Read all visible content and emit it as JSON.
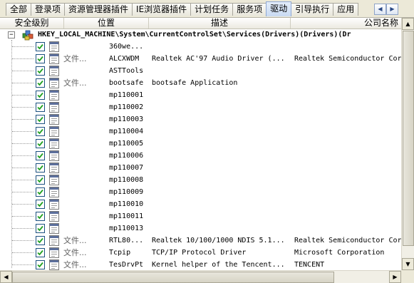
{
  "tabs": [
    {
      "label": "全部",
      "active": false
    },
    {
      "label": "登录项",
      "active": false
    },
    {
      "label": "资源管理器插件",
      "active": false
    },
    {
      "label": "IE浏览器插件",
      "active": false
    },
    {
      "label": "计划任务",
      "active": false
    },
    {
      "label": "服务项",
      "active": false
    },
    {
      "label": "驱动",
      "active": true
    },
    {
      "label": "引导执行",
      "active": false
    },
    {
      "label": "应用",
      "active": false
    }
  ],
  "columns": {
    "level": "安全级别",
    "location": "位置",
    "description": "描述",
    "company": "公司名称"
  },
  "root": {
    "expander": "⊟",
    "path": "HKEY_LOCAL_MACHINE\\System\\CurrentControlSet\\Services(Drivers)(Drivers)(Dr"
  },
  "rows": [
    {
      "type": "",
      "name": "360we...",
      "desc": "",
      "company": ""
    },
    {
      "type": "文件...",
      "name": "ALCXWDM",
      "desc": "Realtek AC'97 Audio Driver (...",
      "company": "Realtek Semiconductor Cor"
    },
    {
      "type": "",
      "name": "ASTTools",
      "desc": "",
      "company": ""
    },
    {
      "type": "文件...",
      "name": "bootsafe",
      "desc": "bootsafe Application",
      "company": ""
    },
    {
      "type": "",
      "name": "mp110001",
      "desc": "",
      "company": ""
    },
    {
      "type": "",
      "name": "mp110002",
      "desc": "",
      "company": ""
    },
    {
      "type": "",
      "name": "mp110003",
      "desc": "",
      "company": ""
    },
    {
      "type": "",
      "name": "mp110004",
      "desc": "",
      "company": ""
    },
    {
      "type": "",
      "name": "mp110005",
      "desc": "",
      "company": ""
    },
    {
      "type": "",
      "name": "mp110006",
      "desc": "",
      "company": ""
    },
    {
      "type": "",
      "name": "mp110007",
      "desc": "",
      "company": ""
    },
    {
      "type": "",
      "name": "mp110008",
      "desc": "",
      "company": ""
    },
    {
      "type": "",
      "name": "mp110009",
      "desc": "",
      "company": ""
    },
    {
      "type": "",
      "name": "mp110010",
      "desc": "",
      "company": ""
    },
    {
      "type": "",
      "name": "mp110011",
      "desc": "",
      "company": ""
    },
    {
      "type": "",
      "name": "mp110013",
      "desc": "",
      "company": ""
    },
    {
      "type": "文件...",
      "name": "RTL80...",
      "desc": "Realtek 10/100/1000 NDIS 5.1...",
      "company": "Realtek Semiconductor Cor"
    },
    {
      "type": "文件...",
      "name": "Tcpip",
      "desc": "TCP/IP Protocol Driver",
      "company": "Microsoft Corporation"
    },
    {
      "type": "文件...",
      "name": "TesDrvPt",
      "desc": "Kernel helper of the Tencent...",
      "company": "TENCENT"
    }
  ],
  "scroll": {
    "up": "▲",
    "down": "▼",
    "left": "◀",
    "right": "▶",
    "tab_prev": "◀",
    "tab_next": "▶"
  },
  "colors": {
    "checkbox_border": "#1c5180",
    "check_mark": "#21a121",
    "active_tab": "#c9daf2"
  }
}
